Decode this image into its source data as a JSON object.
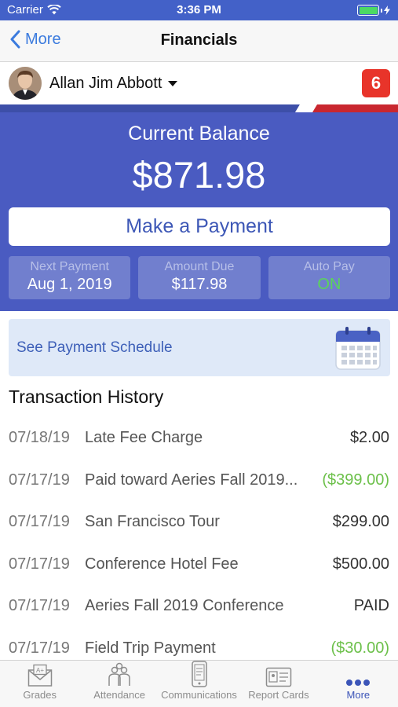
{
  "status_bar": {
    "carrier": "Carrier",
    "time": "3:36 PM"
  },
  "nav": {
    "back_label": "More",
    "title": "Financials"
  },
  "student": {
    "name": "Allan Jim Abbott",
    "badge_count": "6"
  },
  "balance": {
    "label": "Current Balance",
    "amount": "$871.98",
    "pay_button": "Make a Payment",
    "next_payment_label": "Next Payment",
    "next_payment_value": "Aug 1, 2019",
    "amount_due_label": "Amount Due",
    "amount_due_value": "$117.98",
    "auto_pay_label": "Auto Pay",
    "auto_pay_value": "ON"
  },
  "schedule": {
    "label": "See Payment Schedule"
  },
  "transactions": {
    "title": "Transaction History",
    "rows": [
      {
        "date": "07/18/19",
        "desc": "Late Fee Charge",
        "amount": "$2.00",
        "credit": false
      },
      {
        "date": "07/17/19",
        "desc": "Paid toward Aeries Fall 2019...",
        "amount": "($399.00)",
        "credit": true
      },
      {
        "date": "07/17/19",
        "desc": "San Francisco Tour",
        "amount": "$299.00",
        "credit": false
      },
      {
        "date": "07/17/19",
        "desc": "Conference Hotel Fee",
        "amount": "$500.00",
        "credit": false
      },
      {
        "date": "07/17/19",
        "desc": "Aeries Fall 2019 Conference",
        "amount": "PAID",
        "credit": false
      },
      {
        "date": "07/17/19",
        "desc": "Field Trip Payment",
        "amount": "($30.00)",
        "credit": true
      }
    ]
  },
  "tabs": [
    {
      "label": "Grades",
      "icon": "grades-icon"
    },
    {
      "label": "Attendance",
      "icon": "attendance-icon"
    },
    {
      "label": "Communications",
      "icon": "communications-icon"
    },
    {
      "label": "Report Cards",
      "icon": "report-cards-icon"
    },
    {
      "label": "More",
      "icon": "more-icon",
      "active": true
    }
  ],
  "colors": {
    "brand": "#4a5bc1",
    "credit": "#6cc04a",
    "badge": "#e8342a",
    "link": "#3b7bde"
  }
}
